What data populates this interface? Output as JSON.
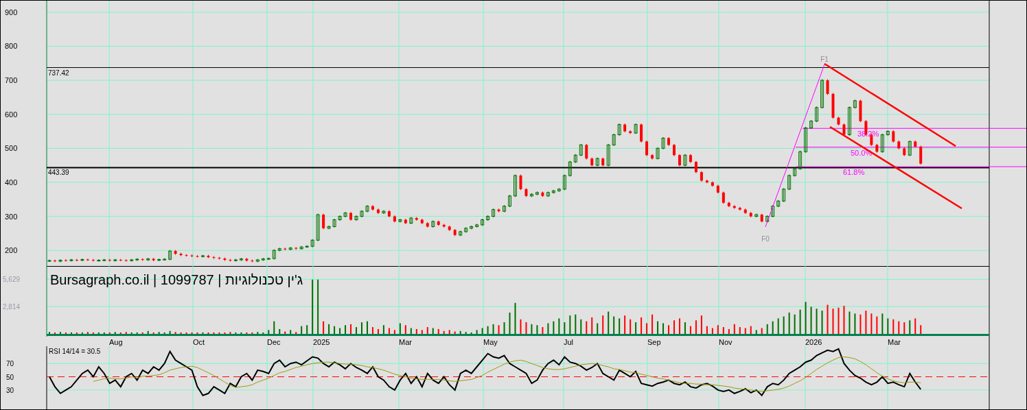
{
  "price": {
    "chart_data": {
      "type": "candlestick",
      "ylim": [
        154,
        934
      ],
      "yticks": [
        200,
        300,
        400,
        500,
        600,
        700,
        800,
        900
      ],
      "grid": true,
      "ohlc": [
        [
          170,
          173,
          167,
          170
        ],
        [
          170,
          173,
          165,
          168
        ],
        [
          168,
          174,
          165,
          171
        ],
        [
          171,
          174,
          167,
          170
        ],
        [
          170,
          175,
          167,
          172
        ],
        [
          172,
          175,
          168,
          171
        ],
        [
          171,
          176,
          168,
          173
        ],
        [
          173,
          176,
          169,
          172
        ],
        [
          172,
          175,
          167,
          170
        ],
        [
          170,
          174,
          167,
          171
        ],
        [
          171,
          175,
          168,
          172
        ],
        [
          172,
          175,
          167,
          170
        ],
        [
          170,
          175,
          167,
          172
        ],
        [
          172,
          175,
          168,
          171
        ],
        [
          171,
          174,
          167,
          170
        ],
        [
          170,
          175,
          167,
          172
        ],
        [
          172,
          177,
          169,
          174
        ],
        [
          174,
          177,
          169,
          172
        ],
        [
          172,
          178,
          169,
          175
        ],
        [
          175,
          178,
          168,
          171
        ],
        [
          171,
          176,
          168,
          173
        ],
        [
          173,
          177,
          170,
          174
        ],
        [
          174,
          201,
          171,
          198
        ],
        [
          198,
          201,
          187,
          190
        ],
        [
          190,
          193,
          183,
          186
        ],
        [
          186,
          189,
          182,
          185
        ],
        [
          185,
          188,
          180,
          183
        ],
        [
          183,
          186,
          179,
          182
        ],
        [
          182,
          187,
          179,
          184
        ],
        [
          184,
          187,
          177,
          180
        ],
        [
          180,
          183,
          175,
          178
        ],
        [
          178,
          181,
          173,
          176
        ],
        [
          176,
          179,
          169,
          172
        ],
        [
          172,
          175,
          167,
          170
        ],
        [
          170,
          175,
          167,
          172
        ],
        [
          172,
          178,
          169,
          175
        ],
        [
          175,
          178,
          167,
          170
        ],
        [
          170,
          173,
          165,
          168
        ],
        [
          168,
          175,
          165,
          172
        ],
        [
          172,
          178,
          169,
          175
        ],
        [
          175,
          179,
          172,
          176
        ],
        [
          176,
          203,
          173,
          200
        ],
        [
          200,
          208,
          197,
          205
        ],
        [
          205,
          208,
          200,
          203
        ],
        [
          203,
          210,
          200,
          207
        ],
        [
          207,
          210,
          202,
          205
        ],
        [
          205,
          213,
          202,
          210
        ],
        [
          210,
          215,
          207,
          212
        ],
        [
          212,
          233,
          209,
          230
        ],
        [
          230,
          308,
          227,
          305
        ],
        [
          305,
          308,
          262,
          265
        ],
        [
          265,
          273,
          262,
          270
        ],
        [
          270,
          293,
          267,
          290
        ],
        [
          290,
          303,
          287,
          300
        ],
        [
          300,
          313,
          297,
          310
        ],
        [
          310,
          313,
          287,
          290
        ],
        [
          290,
          303,
          287,
          300
        ],
        [
          300,
          318,
          297,
          315
        ],
        [
          315,
          333,
          312,
          330
        ],
        [
          330,
          333,
          317,
          320
        ],
        [
          320,
          323,
          307,
          310
        ],
        [
          310,
          318,
          307,
          315
        ],
        [
          315,
          318,
          297,
          300
        ],
        [
          300,
          303,
          282,
          285
        ],
        [
          285,
          293,
          282,
          290
        ],
        [
          290,
          293,
          277,
          280
        ],
        [
          280,
          298,
          277,
          295
        ],
        [
          295,
          298,
          287,
          290
        ],
        [
          290,
          293,
          277,
          280
        ],
        [
          280,
          283,
          267,
          270
        ],
        [
          270,
          288,
          267,
          285
        ],
        [
          285,
          288,
          272,
          275
        ],
        [
          275,
          278,
          267,
          270
        ],
        [
          270,
          273,
          257,
          260
        ],
        [
          260,
          263,
          242,
          245
        ],
        [
          245,
          258,
          242,
          255
        ],
        [
          255,
          268,
          252,
          265
        ],
        [
          265,
          273,
          262,
          270
        ],
        [
          270,
          278,
          267,
          275
        ],
        [
          275,
          293,
          272,
          290
        ],
        [
          290,
          303,
          287,
          300
        ],
        [
          300,
          323,
          297,
          320
        ],
        [
          320,
          323,
          312,
          315
        ],
        [
          315,
          333,
          312,
          330
        ],
        [
          330,
          363,
          327,
          360
        ],
        [
          360,
          423,
          357,
          420
        ],
        [
          420,
          423,
          377,
          380
        ],
        [
          380,
          383,
          357,
          360
        ],
        [
          360,
          368,
          357,
          365
        ],
        [
          365,
          373,
          362,
          370
        ],
        [
          370,
          373,
          357,
          360
        ],
        [
          360,
          373,
          357,
          370
        ],
        [
          370,
          378,
          367,
          375
        ],
        [
          375,
          383,
          372,
          380
        ],
        [
          380,
          423,
          377,
          420
        ],
        [
          420,
          463,
          417,
          460
        ],
        [
          460,
          483,
          457,
          480
        ],
        [
          480,
          513,
          477,
          510
        ],
        [
          510,
          513,
          467,
          470
        ],
        [
          470,
          473,
          447,
          450
        ],
        [
          450,
          473,
          447,
          470
        ],
        [
          470,
          473,
          447,
          450
        ],
        [
          450,
          513,
          447,
          510
        ],
        [
          510,
          543,
          507,
          540
        ],
        [
          540,
          573,
          537,
          570
        ],
        [
          570,
          573,
          547,
          550
        ],
        [
          550,
          553,
          542,
          545
        ],
        [
          545,
          573,
          542,
          570
        ],
        [
          570,
          573,
          517,
          520
        ],
        [
          520,
          523,
          477,
          480
        ],
        [
          480,
          483,
          467,
          470
        ],
        [
          470,
          503,
          467,
          500
        ],
        [
          500,
          533,
          497,
          530
        ],
        [
          530,
          533,
          507,
          510
        ],
        [
          510,
          513,
          477,
          480
        ],
        [
          480,
          483,
          447,
          450
        ],
        [
          450,
          483,
          447,
          480
        ],
        [
          480,
          483,
          457,
          460
        ],
        [
          460,
          463,
          427,
          430
        ],
        [
          430,
          433,
          402,
          405
        ],
        [
          405,
          408,
          397,
          400
        ],
        [
          400,
          403,
          387,
          390
        ],
        [
          390,
          393,
          367,
          370
        ],
        [
          370,
          373,
          337,
          340
        ],
        [
          340,
          343,
          327,
          330
        ],
        [
          330,
          333,
          322,
          325
        ],
        [
          325,
          328,
          317,
          320
        ],
        [
          320,
          323,
          307,
          310
        ],
        [
          310,
          313,
          297,
          300
        ],
        [
          300,
          308,
          297,
          305
        ],
        [
          305,
          308,
          282,
          285
        ],
        [
          285,
          303,
          282,
          300
        ],
        [
          300,
          333,
          297,
          330
        ],
        [
          330,
          348,
          327,
          345
        ],
        [
          345,
          383,
          342,
          380
        ],
        [
          380,
          423,
          377,
          420
        ],
        [
          420,
          443,
          417,
          440
        ],
        [
          440,
          493,
          437,
          490
        ],
        [
          490,
          563,
          487,
          560
        ],
        [
          560,
          583,
          557,
          580
        ],
        [
          580,
          623,
          577,
          620
        ],
        [
          620,
          703,
          617,
          700
        ],
        [
          700,
          703,
          657,
          660
        ],
        [
          660,
          663,
          587,
          590
        ],
        [
          590,
          593,
          567,
          570
        ],
        [
          570,
          573,
          537,
          540
        ],
        [
          540,
          623,
          537,
          620
        ],
        [
          620,
          643,
          617,
          640
        ],
        [
          640,
          643,
          577,
          580
        ],
        [
          580,
          583,
          537,
          540
        ],
        [
          540,
          543,
          507,
          510
        ],
        [
          510,
          513,
          487,
          490
        ],
        [
          490,
          543,
          487,
          540
        ],
        [
          540,
          553,
          537,
          550
        ],
        [
          550,
          553,
          517,
          520
        ],
        [
          520,
          523,
          497,
          500
        ],
        [
          500,
          503,
          477,
          480
        ],
        [
          480,
          523,
          477,
          520
        ],
        [
          520,
          523,
          502,
          505
        ],
        [
          505,
          508,
          452,
          455
        ],
        null,
        null,
        null,
        null,
        null,
        null,
        null,
        null,
        null,
        null,
        null,
        null
      ],
      "ref_lines": [
        {
          "axis": "y",
          "value": 737.42,
          "label": "737.42",
          "color": "#000000"
        },
        {
          "axis": "y",
          "value": 443.39,
          "label": "443.39",
          "color": "#000000"
        },
        {
          "axis": "y",
          "value": 558.6,
          "color": "#ff00ff"
        },
        {
          "axis": "y",
          "value": 503.5,
          "color": "#ff00ff"
        },
        {
          "axis": "y",
          "value": 446,
          "color": "#ff00ff"
        }
      ]
    },
    "fib_labels": [
      "38.2%",
      "50.0%",
      "61.8%"
    ],
    "drawing_labels": [
      "F0",
      "F1"
    ]
  },
  "volume": {
    "chart_data": {
      "type": "bar",
      "title": "Bursagraph.co.il | 1099787 | ג'ין טכנולוגיות",
      "ylim": [
        0,
        7000
      ],
      "grid": true,
      "yticks": [
        {
          "value": 2814,
          "label": "2,814"
        },
        {
          "value": 5629,
          "label": "5,629"
        }
      ],
      "values": [
        200,
        150,
        200,
        150,
        150,
        150,
        150,
        200,
        150,
        150,
        150,
        150,
        200,
        150,
        200,
        150,
        150,
        150,
        300,
        150,
        200,
        150,
        300,
        200,
        150,
        150,
        150,
        150,
        150,
        150,
        150,
        150,
        150,
        200,
        150,
        150,
        150,
        150,
        200,
        150,
        400,
        1300,
        500,
        250,
        400,
        200,
        800,
        900,
        5600,
        5600,
        1300,
        1000,
        800,
        600,
        900,
        1000,
        700,
        1200,
        1300,
        700,
        500,
        900,
        600,
        400,
        1100,
        900,
        600,
        500,
        400,
        700,
        600,
        500,
        300,
        400,
        250,
        300,
        200,
        150,
        400,
        600,
        800,
        1000,
        900,
        1200,
        2200,
        3200,
        1500,
        1200,
        1000,
        900,
        700,
        1100,
        1300,
        1600,
        1200,
        1900,
        2000,
        1500,
        1300,
        1700,
        1100,
        1900,
        2300,
        1800,
        1600,
        1900,
        1500,
        1200,
        1700,
        1100,
        2000,
        1300,
        1100,
        900,
        1400,
        1600,
        1200,
        800,
        1400,
        1900,
        800,
        600,
        900,
        700,
        500,
        1000,
        700,
        600,
        800,
        400,
        600,
        1000,
        1300,
        1600,
        1800,
        2200,
        2000,
        2500,
        3300,
        2800,
        2600,
        2400,
        3000,
        2600,
        2700,
        2900,
        2300,
        2100,
        2000,
        2400,
        2100,
        1800,
        2100,
        1600,
        1500,
        1300,
        1200,
        1400,
        1600,
        900,
        null,
        null,
        null,
        null,
        null,
        null,
        null,
        null,
        null,
        null,
        null,
        null
      ]
    }
  },
  "time_axis": [
    "Aug",
    "Oct",
    "Dec",
    "2025",
    "Mar",
    "May",
    "Jul",
    "Sep",
    "Nov",
    "2026",
    "Mar"
  ],
  "rsi": {
    "chart_data": {
      "type": "line",
      "title": "RSI 14/14 = 30.5",
      "ylim": [
        1,
        96
      ],
      "yticks": [
        30,
        50,
        70
      ],
      "grid": true,
      "series": [
        {
          "color": "#000000",
          "values": [
            50,
            35,
            25,
            30,
            35,
            45,
            55,
            60,
            50,
            65,
            55,
            40,
            45,
            35,
            50,
            55,
            45,
            60,
            55,
            65,
            60,
            70,
            88,
            75,
            70,
            65,
            60,
            35,
            22,
            25,
            35,
            30,
            25,
            40,
            35,
            50,
            55,
            45,
            60,
            58,
            55,
            70,
            75,
            65,
            70,
            72,
            68,
            74,
            80,
            78,
            70,
            65,
            72,
            68,
            62,
            70,
            64,
            60,
            55,
            65,
            50,
            45,
            35,
            30,
            45,
            55,
            40,
            50,
            35,
            55,
            45,
            40,
            50,
            38,
            30,
            55,
            60,
            55,
            65,
            75,
            85,
            80,
            78,
            82,
            70,
            65,
            60,
            55,
            40,
            45,
            60,
            70,
            75,
            68,
            80,
            72,
            70,
            66,
            60,
            64,
            70,
            55,
            50,
            45,
            60,
            55,
            50,
            58,
            40,
            38,
            36,
            40,
            42,
            45,
            40,
            38,
            42,
            35,
            33,
            38,
            40,
            36,
            30,
            28,
            30,
            25,
            28,
            32,
            26,
            30,
            22,
            35,
            40,
            38,
            45,
            55,
            60,
            65,
            72,
            75,
            82,
            86,
            90,
            88,
            92,
            70,
            60,
            52,
            48,
            42,
            38,
            42,
            50,
            40,
            42,
            38,
            35,
            55,
            42,
            31,
            null,
            null,
            null,
            null,
            null,
            null,
            null,
            null,
            null,
            null,
            null,
            null
          ]
        },
        {
          "color": "#9a9a10",
          "values": [
            null,
            null,
            null,
            null,
            null,
            null,
            null,
            null,
            43,
            45,
            47,
            48,
            47,
            47,
            48,
            50,
            48,
            51,
            51,
            52,
            53,
            56,
            60,
            62,
            64,
            65,
            66,
            64,
            60,
            56,
            52,
            47,
            42,
            37,
            34,
            35,
            36,
            38,
            42,
            45,
            48,
            52,
            56,
            58,
            61,
            64,
            66,
            68,
            70,
            71,
            72,
            72,
            71,
            70,
            69,
            69,
            68,
            67,
            65,
            64,
            62,
            60,
            57,
            54,
            52,
            50,
            48,
            47,
            46,
            46,
            46,
            46,
            45,
            44,
            43,
            44,
            45,
            46,
            49,
            52,
            57,
            61,
            65,
            69,
            72,
            74,
            75,
            73,
            70,
            67,
            64,
            62,
            61,
            61,
            62,
            64,
            66,
            68,
            69,
            70,
            69,
            67,
            65,
            62,
            61,
            59,
            57,
            56,
            54,
            52,
            50,
            48,
            47,
            45,
            43,
            41,
            40,
            40,
            39,
            39,
            38,
            38,
            37,
            36,
            35,
            33,
            32,
            31,
            30,
            29,
            28,
            29,
            30,
            31,
            33,
            36,
            40,
            44,
            49,
            55,
            61,
            66,
            71,
            75,
            79,
            80,
            79,
            77,
            73,
            68,
            62,
            56,
            51,
            47,
            44,
            42,
            41,
            42,
            42,
            41,
            null,
            null,
            null,
            null,
            null,
            null,
            null,
            null,
            null,
            null,
            null,
            null
          ]
        }
      ],
      "ref_lines": [
        {
          "axis": "y",
          "value": 50,
          "color": "#ff0000"
        }
      ]
    }
  }
}
